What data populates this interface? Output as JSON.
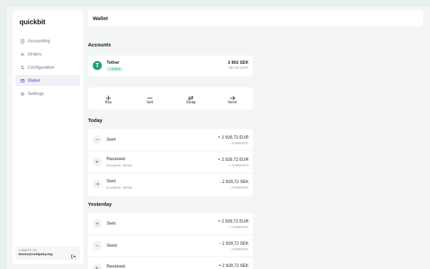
{
  "app": {
    "brand": "quickbit"
  },
  "nav": [
    {
      "label": "Accounting",
      "icon": "document-icon",
      "active": false
    },
    {
      "label": "Orders",
      "icon": "list-icon",
      "active": false
    },
    {
      "label": "Configuration",
      "icon": "sliders-icon",
      "active": false
    },
    {
      "label": "Wallet",
      "icon": "wallet-icon",
      "active": true
    },
    {
      "label": "Settings",
      "icon": "gear-icon",
      "active": false
    }
  ],
  "user": {
    "logged_in_label": "Logged in as",
    "email": "booso@company.org"
  },
  "header": {
    "title": "Wallet"
  },
  "accounts": {
    "title": "Accounts",
    "items": [
      {
        "name": "Tether",
        "badge": "+ 3,26%",
        "amount": "2 802 SEK",
        "sub": "283,35 USDT"
      }
    ]
  },
  "actions": [
    {
      "label": "Buy",
      "icon": "plus-icon"
    },
    {
      "label": "Sell",
      "icon": "minus-icon"
    },
    {
      "label": "Swap",
      "icon": "swap-icon"
    },
    {
      "label": "Send",
      "icon": "arrow-right-icon"
    }
  ],
  "today": {
    "title": "Today",
    "rows": [
      {
        "type": "Sent",
        "addr": "",
        "amount": "+ 2 929,72 EUR",
        "sub": "- 0,0068 BTC",
        "icon": "minus-icon"
      },
      {
        "type": "Received",
        "addr": "bc1qaruei...f5mdq",
        "amount": "+ 2 929,72 EUR",
        "sub": "+ 0,0068 BTC",
        "icon": "arrow-left-icon"
      },
      {
        "type": "Sent",
        "addr": "bc1qaruei...f5mdq",
        "amount": "- 2 929,72 SEK",
        "sub": "- 0,0068 BTC",
        "icon": "arrow-right-icon"
      }
    ]
  },
  "yesterday": {
    "title": "Yesterday",
    "rows": [
      {
        "type": "Sent",
        "addr": "",
        "amount": "+ 2 929,72 EUR",
        "sub": "+ 0,0068 BTC",
        "icon": "plus-icon"
      },
      {
        "type": "Send",
        "addr": "",
        "amount": "- 2 929,72 SEK",
        "sub": "- 0,0068 BTC",
        "icon": "minus-icon"
      },
      {
        "type": "Received",
        "addr": "",
        "amount": "+ 2 929,72 SEK",
        "sub": "",
        "icon": "arrow-left-icon"
      }
    ]
  },
  "colors": {
    "accent": "#5a4fd6",
    "tether": "#1f9f7a",
    "positive": "#1f9f5a"
  }
}
